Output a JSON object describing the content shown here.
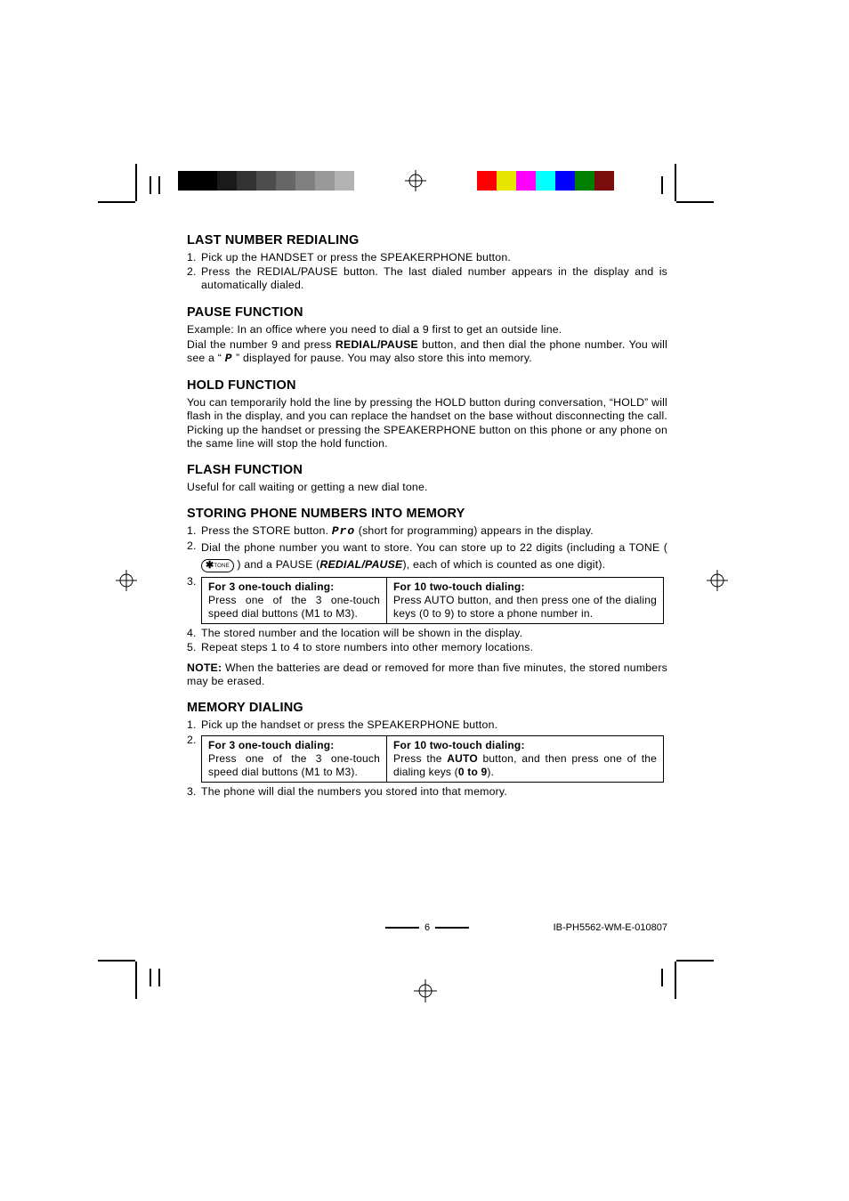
{
  "sections": {
    "redial": {
      "title": "LAST NUMBER REDIALING",
      "item1": "Pick up the HANDSET or press the SPEAKERPHONE button.",
      "item2": "Press the REDIAL/PAUSE button. The last dialed number appears in the display and is automatically dialed."
    },
    "pause": {
      "title": "PAUSE FUNCTION",
      "line1": "Example: In an office where you need to dial a 9 first to get an outside line.",
      "line2a": "Dial the number 9 and press ",
      "line2b": "REDIAL/PAUSE",
      "line2c": " button, and then dial the phone number. You will see a “ ",
      "line2d": "P",
      "line2e": " ” displayed for pause. You may also store this into memory."
    },
    "hold": {
      "title": "HOLD FUNCTION",
      "body": "You can temporarily hold the line by pressing the HOLD button during conversation, “HOLD” will flash in the display, and you can replace the handset on the base without disconnecting the call. Picking up the handset or pressing the SPEAKERPHONE button on this phone or any phone on the same line will stop the hold function."
    },
    "flash": {
      "title": "FLASH FUNCTION",
      "body": "Useful for call waiting or getting a new dial tone."
    },
    "store": {
      "title": "STORING PHONE NUMBERS INTO MEMORY",
      "item1a": "Press the STORE button. ",
      "item1b": "Pro",
      "item1c": " (short for programming) appears in the display.",
      "item2a": "Dial the phone number you want to store. You can store up to 22 digits (including a TONE ( ",
      "item2b": " ) and a PAUSE (",
      "item2c": "REDIAL/PAUSE",
      "item2d": "), each of which is counted as one digit).",
      "tone_label": "TONE",
      "table": {
        "lhead": "For 3 one-touch dialing:",
        "lbody": "Press one of the 3 one-touch speed dial buttons (M1 to M3).",
        "rhead": "For 10 two-touch dialing:",
        "rbody": "Press AUTO button, and then press one of the dialing keys (0 to 9) to store a phone number in."
      },
      "item4": "The stored number and the location will be shown in the display.",
      "item5": "Repeat steps 1 to 4 to store numbers into other memory locations.",
      "note_prefix": "NOTE:",
      "note_body": " When the batteries are dead or removed for more than five minutes, the stored numbers may be erased."
    },
    "memdial": {
      "title": "MEMORY DIALING",
      "item1": "Pick up the handset or press the SPEAKERPHONE button.",
      "table": {
        "lhead": "For 3 one-touch dialing:",
        "lbody": "Press one of the 3 one-touch speed dial buttons (M1 to M3).",
        "rhead": "For 10 two-touch dialing:",
        "rbody_a": "Press the ",
        "rbody_b": "AUTO",
        "rbody_c": " button, and then press one of the dialing keys (",
        "rbody_d": "0 to 9",
        "rbody_e": ")."
      },
      "item3": "The phone will dial the numbers you stored into that memory."
    }
  },
  "ol": {
    "n1": "1.",
    "n2": "2.",
    "n3": "3.",
    "n4": "4.",
    "n5": "5."
  },
  "footer": {
    "page": "6",
    "code": "IB-PH5562-WM-E-010807"
  },
  "swatches": [
    "#000000",
    "#000000",
    "#1a1a1a",
    "#333333",
    "#4d4d4d",
    "#666666",
    "#808080",
    "#999999",
    "#b3b3b3",
    "#ffffff",
    "#ffffff",
    "gap",
    "#ffffff",
    "#ffffff",
    "#ff0000",
    "#e6e600",
    "#ff00ff",
    "#00ffff",
    "#0000ff",
    "#008000",
    "#7a0e0e",
    "#ffffff",
    "#ffffff"
  ]
}
